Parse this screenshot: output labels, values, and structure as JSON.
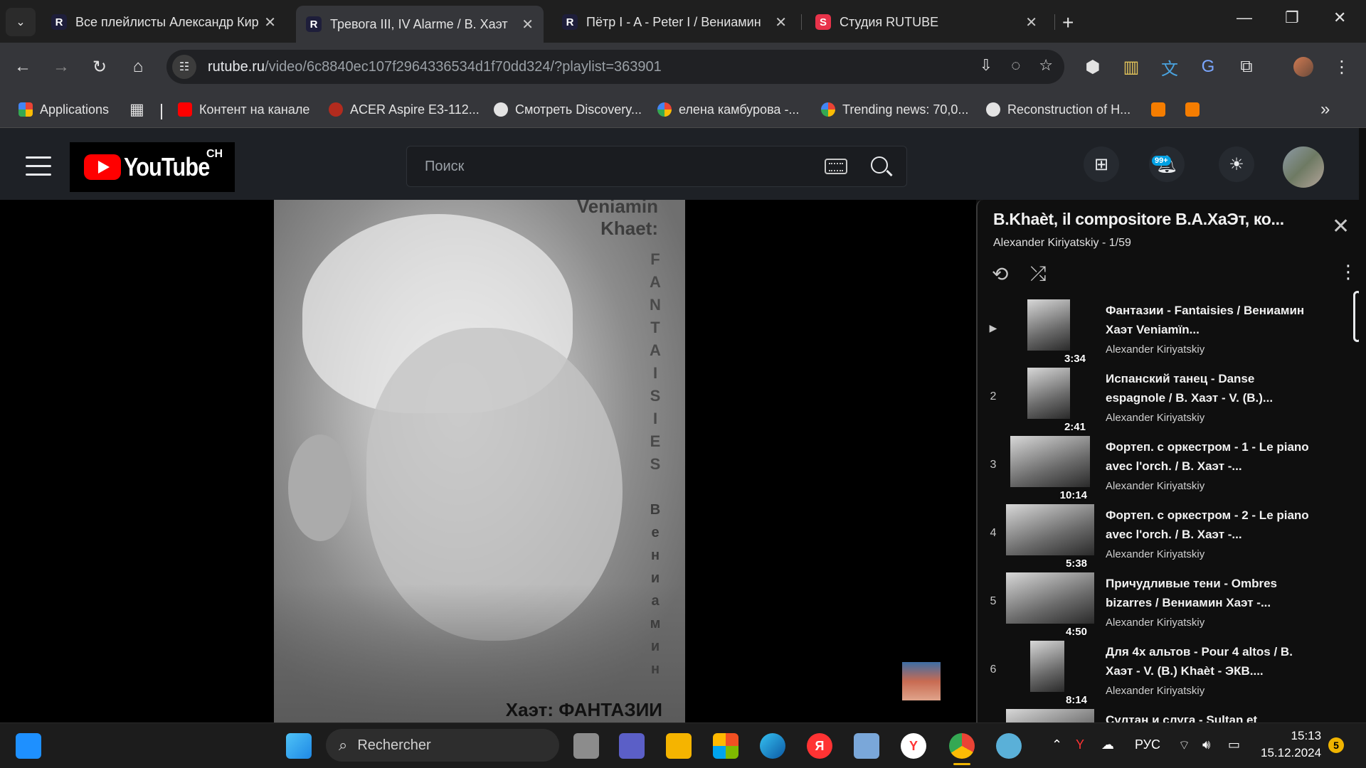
{
  "browser": {
    "tabs": [
      {
        "title": "Все плейлисты Александр Кир",
        "favicon": "rutube-icon"
      },
      {
        "title": "Тревога III, IV Alarme / B. Хаэт",
        "favicon": "rutube-icon"
      },
      {
        "title": "Пётр I - A - Peter I / Вениамин",
        "favicon": "rutube-icon"
      },
      {
        "title": "Студия RUTUBE",
        "favicon": "rutube-studio-icon"
      }
    ],
    "url_host": "rutube.ru",
    "url_path": "/video/6c8840ec107f2964336534d1f70dd324/?playlist=363901",
    "bookmarks": [
      "Applications",
      "Контент на канале",
      "ACER Aspire E3-112...",
      "Смотреть Discovery...",
      "елена камбурова -...",
      "Trending news: 70,0...",
      "Reconstruction of H..."
    ]
  },
  "site": {
    "logo_text": "YouTube",
    "logo_sup": "CH",
    "search_placeholder": "Поиск",
    "notifications_badge": "99+"
  },
  "video": {
    "poster_top_line1": "Veniamin",
    "poster_top_line2": "Khaet:",
    "poster_vertical_1": [
      "F",
      "A",
      "N",
      "T",
      "A",
      "I",
      "S",
      "I",
      "E",
      "S"
    ],
    "poster_vertical_2": [
      "В",
      "е",
      "н",
      "и",
      "а",
      "м",
      "и",
      "н"
    ],
    "poster_bottom": "Хаэт: ФАНТАЗИИ"
  },
  "playlist": {
    "title": "B.Khaèt, il compositore В.А.ХаЭт, ко...",
    "subtitle": "Alexander Kiriyatskiy - 1/59",
    "items": [
      {
        "index": "▶",
        "duration": "3:34",
        "title": "Фантазии - Fantaisies / Вениамин Хаэт Veniamïn...",
        "channel": "Alexander Kiriyatskiy"
      },
      {
        "index": "2",
        "duration": "2:41",
        "title": "Испанский танец - Danse espagnole / В. Хаэт - V. (B.)...",
        "channel": "Alexander Kiriyatskiy"
      },
      {
        "index": "3",
        "duration": "10:14",
        "title": "Фортеп. с оркестром - 1 - Le piano avec l'orch. / В. Хаэт -...",
        "channel": "Alexander Kiriyatskiy"
      },
      {
        "index": "4",
        "duration": "5:38",
        "title": "Фортеп. с оркестром - 2 - Le piano avec l'orch. / В. Хаэт -...",
        "channel": "Alexander Kiriyatskiy"
      },
      {
        "index": "5",
        "duration": "4:50",
        "title": "Причудливые тени - Ombres bizarres / Вениамин Хаэт -...",
        "channel": "Alexander Kiriyatskiy"
      },
      {
        "index": "6",
        "duration": "8:14",
        "title": "Для 4х альтов - Pour 4 altos / В. Хаэт - V. (B.) Khaèt - ЭКВ....",
        "channel": "Alexander Kiriyatskiy"
      },
      {
        "index": "",
        "duration": "",
        "title": "Султан и слуга - Sultan et",
        "channel": ""
      }
    ]
  },
  "taskbar": {
    "search_placeholder": "Rechercher",
    "language": "РУС",
    "time": "15:13",
    "date": "15.12.2024",
    "notification_count": "5"
  }
}
